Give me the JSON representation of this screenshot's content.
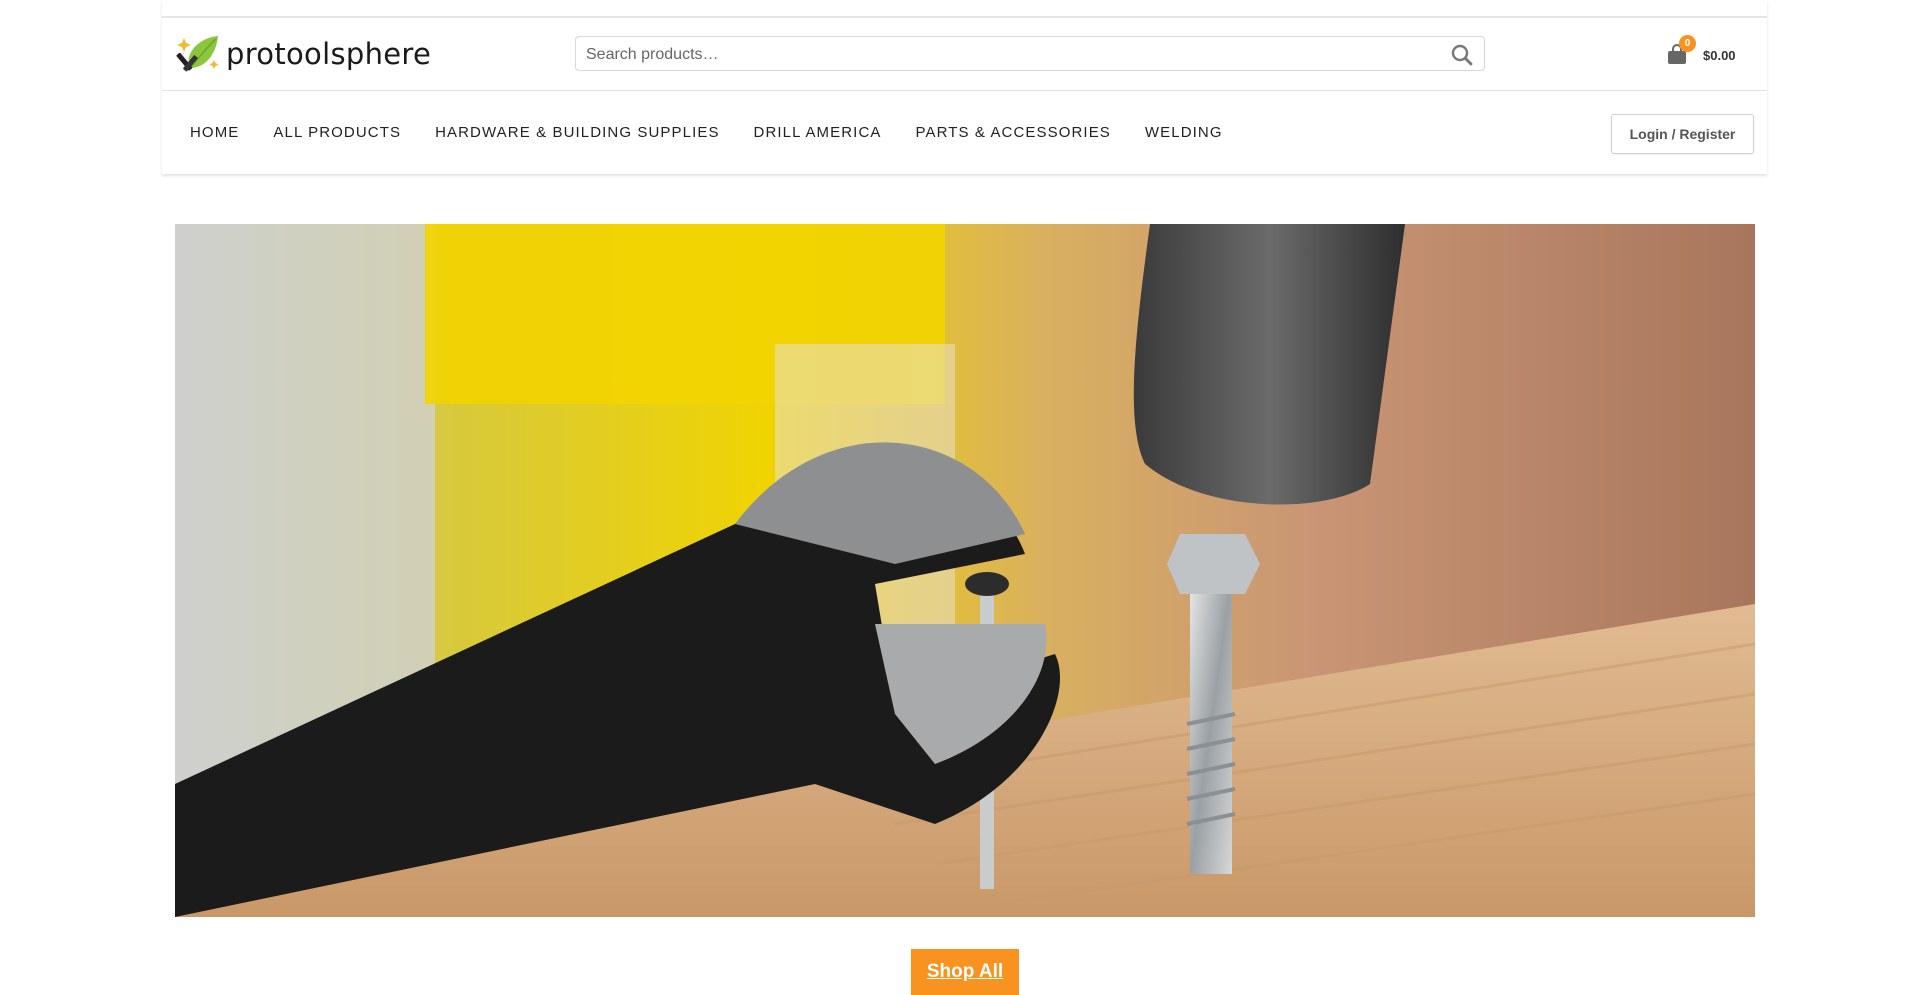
{
  "brand": {
    "name": "protoolsphere",
    "logo_icon": "leaf-tools-logo-icon"
  },
  "search": {
    "placeholder": "Search products…",
    "value": "",
    "icon": "search-icon"
  },
  "cart": {
    "count": "0",
    "total": "$0.00",
    "icon": "shopping-bag-icon"
  },
  "nav": {
    "items": [
      {
        "label": "HOME"
      },
      {
        "label": "ALL PRODUCTS"
      },
      {
        "label": "HARDWARE & BUILDING SUPPLIES"
      },
      {
        "label": "DRILL AMERICA"
      },
      {
        "label": "PARTS & ACCESSORIES"
      },
      {
        "label": "WELDING"
      }
    ]
  },
  "account": {
    "login_label": "Login / Register"
  },
  "hero": {
    "image": "wrench-nail-screw-hammer-photo"
  },
  "cta": {
    "shop_all_label": "Shop All"
  },
  "colors": {
    "accent": "#f7931e",
    "badge": "#f7931e",
    "logo_green": "#8cc63f"
  }
}
